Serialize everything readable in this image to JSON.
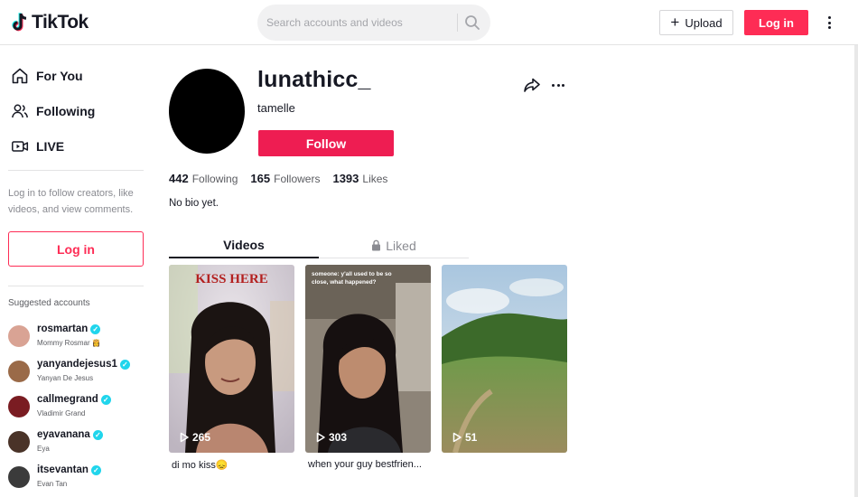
{
  "header": {
    "brand": "TikTok",
    "search_placeholder": "Search accounts and videos",
    "upload_label": "Upload",
    "login_label": "Log in"
  },
  "sidebar": {
    "nav": [
      {
        "label": "For You",
        "icon": "home-icon"
      },
      {
        "label": "Following",
        "icon": "following-icon"
      },
      {
        "label": "LIVE",
        "icon": "live-icon"
      }
    ],
    "login_prompt": "Log in to follow creators, like videos, and view comments.",
    "login_label": "Log in",
    "suggested_title": "Suggested accounts",
    "accounts": [
      {
        "username": "rosmartan",
        "display": "Mommy Rosmar",
        "display_emoji": "👸",
        "verified": true,
        "avatar_color": "#d9a394"
      },
      {
        "username": "yanyandejesus1",
        "display": "Yanyan De Jesus",
        "verified": true,
        "avatar_color": "#9a6a48"
      },
      {
        "username": "callmegrand",
        "display": "Vladimir Grand",
        "verified": true,
        "avatar_color": "#7a1c22"
      },
      {
        "username": "eyavanana",
        "display": "Eya",
        "verified": true,
        "avatar_color": "#4a3328"
      },
      {
        "username": "itsevantan",
        "display": "Evan Tan",
        "verified": true,
        "avatar_color": "#3b3b3b"
      }
    ]
  },
  "profile": {
    "username": "lunathicc_",
    "nickname": "tamelle",
    "follow_label": "Follow",
    "stats": {
      "following": {
        "count": "442",
        "label": "Following"
      },
      "followers": {
        "count": "165",
        "label": "Followers"
      },
      "likes": {
        "count": "1393",
        "label": "Likes"
      }
    },
    "bio": "No bio yet."
  },
  "tabs": {
    "videos": "Videos",
    "liked": "Liked"
  },
  "videos": [
    {
      "views": "265",
      "caption": "di mo kiss😞",
      "overlay": "KISS HERE"
    },
    {
      "views": "303",
      "caption": "when your guy bestfrien...",
      "overlay": "someone: y'all used to be so close, what happened?"
    },
    {
      "views": "51",
      "caption": ""
    }
  ],
  "colors": {
    "accent": "#fe2c55",
    "follow": "#ee1d52",
    "verified": "#20d5ec"
  }
}
